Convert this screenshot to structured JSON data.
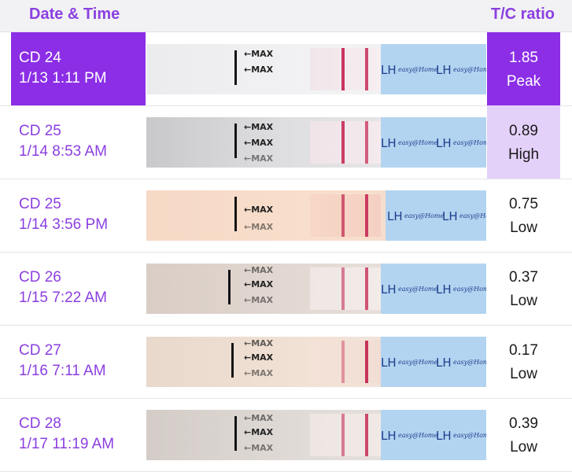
{
  "header": {
    "date_label": "Date & Time",
    "ratio_label": "T/C ratio"
  },
  "colors": {
    "accent": "#8b3fe0",
    "selected_bg": "#8b2ee6",
    "high_bg": "#e4d1f9"
  },
  "strip_labels": {
    "max": "←MAX",
    "lh": "LH",
    "brand": "easy@Home"
  },
  "rows": [
    {
      "cd": "CD 24",
      "datetime": "1/13 1:11 PM",
      "ratio": "1.85",
      "level": "Peak",
      "selected": true
    },
    {
      "cd": "CD 25",
      "datetime": "1/14 8:53 AM",
      "ratio": "0.89",
      "level": "High",
      "selected": false
    },
    {
      "cd": "CD 25",
      "datetime": "1/14 3:56 PM",
      "ratio": "0.75",
      "level": "Low",
      "selected": false
    },
    {
      "cd": "CD 26",
      "datetime": "1/15 7:22 AM",
      "ratio": "0.37",
      "level": "Low",
      "selected": false
    },
    {
      "cd": "CD 27",
      "datetime": "1/16 7:11 AM",
      "ratio": "0.17",
      "level": "Low",
      "selected": false
    },
    {
      "cd": "CD 28",
      "datetime": "1/17 11:19 AM",
      "ratio": "0.39",
      "level": "Low",
      "selected": false
    }
  ]
}
